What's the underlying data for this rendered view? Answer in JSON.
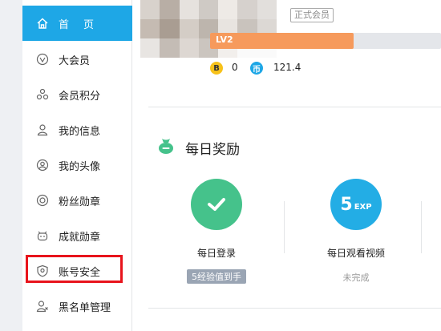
{
  "sidebar": {
    "items": [
      {
        "label": "首页",
        "icon": "home-icon"
      },
      {
        "label": "大会员",
        "icon": "vip-icon"
      },
      {
        "label": "会员积分",
        "icon": "points-icon"
      },
      {
        "label": "我的信息",
        "icon": "user-icon"
      },
      {
        "label": "我的头像",
        "icon": "avatar-icon"
      },
      {
        "label": "粉丝勋章",
        "icon": "medal-icon"
      },
      {
        "label": "成就勋章",
        "icon": "achievement-icon"
      },
      {
        "label": "账号安全",
        "icon": "shield-icon"
      },
      {
        "label": "黑名单管理",
        "icon": "blacklist-icon"
      }
    ],
    "active_index": 0,
    "highlighted_index": 7
  },
  "profile": {
    "member_badge": "正式会员",
    "level": "LV2",
    "level_progress": 0.62,
    "coin_b_symbol": "B",
    "coin_b_value": "0",
    "coin_m_symbol": "币",
    "coin_m_value": "121.4"
  },
  "daily_reward": {
    "title": "每日奖励",
    "tasks": [
      {
        "name": "每日登录",
        "status": "5经验值到手",
        "icon": "check-icon"
      },
      {
        "name": "每日观看视频",
        "status": "未完成",
        "icon": "exp-icon",
        "exp_number": "5",
        "exp_text": "EXP"
      }
    ]
  },
  "colors": {
    "accent": "#1ea7e6",
    "level_bar": "#f69a5c",
    "login_green": "#45c28b",
    "highlight_red": "#e8141c"
  }
}
